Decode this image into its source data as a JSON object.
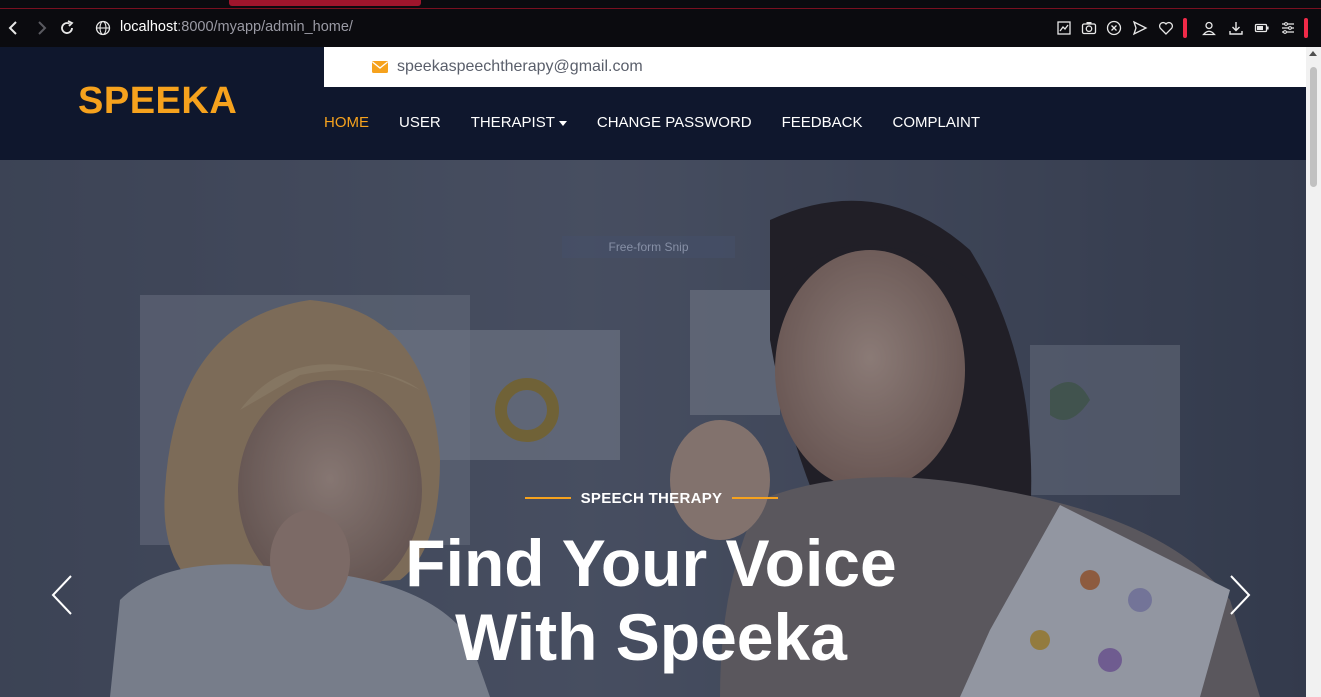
{
  "browser": {
    "url_host": "localhost",
    "url_path": ":8000/myapp/admin_home/"
  },
  "topbar": {
    "email": "speekaspeechtherapy@gmail.com"
  },
  "header": {
    "logo": "SPEEKA",
    "nav": {
      "home": "HOME",
      "user": "USER",
      "therapist": "THERAPIST",
      "change_password": "CHANGE PASSWORD",
      "feedback": "FEEDBACK",
      "complaint": "COMPLAINT"
    }
  },
  "hero": {
    "snip_label": "Free-form Snip",
    "eyebrow": "SPEECH THERAPY",
    "title_line1": "Find Your Voice",
    "title_line2": "With Speeka"
  },
  "colors": {
    "accent": "#f6a21d",
    "header_bg": "#0f172d",
    "browser_red": "#ef2a48"
  },
  "icons": [
    "back-icon",
    "forward-icon",
    "reload-icon",
    "globe-icon",
    "chart-icon",
    "camera-icon",
    "shield-icon",
    "send-icon",
    "heart-icon",
    "profile-icon",
    "download-icon",
    "battery-icon",
    "menu-icon",
    "envelope-icon",
    "caret-down-icon",
    "chevron-left-icon",
    "chevron-right-icon"
  ]
}
